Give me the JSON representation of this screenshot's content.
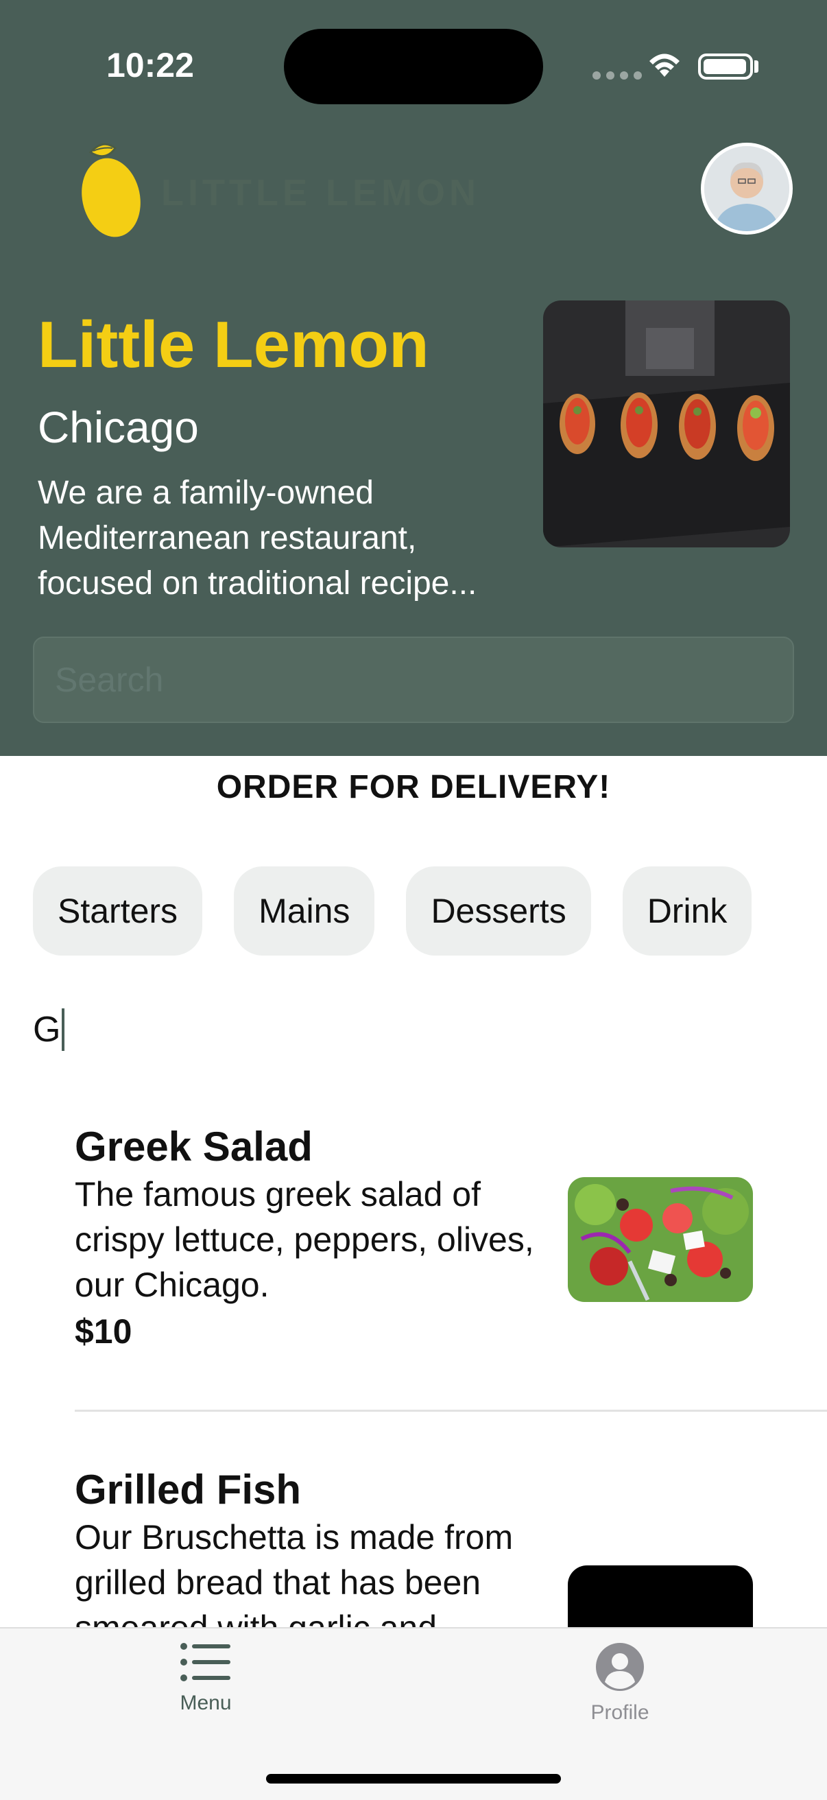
{
  "status_bar": {
    "time": "10:22"
  },
  "header": {
    "logo_text": "LITTLE LEMON"
  },
  "hero": {
    "title": "Little Lemon",
    "city": "Chicago",
    "description_lines": [
      "We are a family-owned",
      "Mediterranean restaurant,",
      "focused on traditional recipe..."
    ]
  },
  "search": {
    "placeholder": "Search",
    "value": ""
  },
  "order": {
    "title": "ORDER FOR DELIVERY!",
    "categories": [
      "Starters",
      "Mains",
      "Desserts",
      "Drink"
    ]
  },
  "filter_input": {
    "value": "G"
  },
  "menu_items": [
    {
      "name": "Greek Salad",
      "description_lines": [
        "The famous greek salad of",
        "crispy lettuce, peppers, olives,",
        "our Chicago."
      ],
      "price": "$10"
    },
    {
      "name": "Grilled Fish",
      "description_lines": [
        "Our Bruschetta is made from",
        "grilled bread that has been",
        "smeared with garlic and"
      ]
    }
  ],
  "tab_bar": {
    "tabs": [
      {
        "label": "Menu",
        "icon": "list-icon",
        "active": true,
        "color": "#495E57"
      },
      {
        "label": "Profile",
        "icon": "person-circle-icon",
        "active": false,
        "color": "#8e8e93"
      }
    ]
  },
  "colors": {
    "primary": "#495E57",
    "accent": "#F4CE14",
    "chip_bg": "#EDEFEE"
  }
}
